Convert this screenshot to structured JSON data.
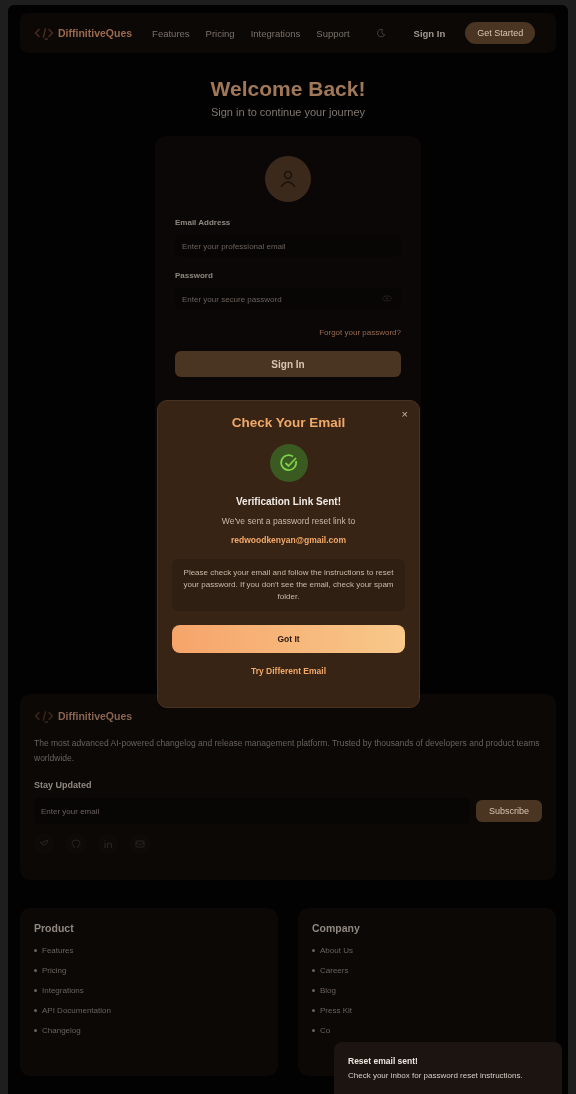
{
  "header": {
    "brand": "DiffinitiveQues",
    "nav": [
      "Features",
      "Pricing",
      "Integrations",
      "Support"
    ],
    "sign_in": "Sign In",
    "cta": "Get Started"
  },
  "login": {
    "title": "Welcome Back!",
    "subtitle": "Sign in to continue your journey",
    "email": {
      "label": "Email Address",
      "placeholder": "Enter your professional email"
    },
    "password": {
      "label": "Password",
      "placeholder": "Enter your secure password"
    },
    "forgot": "Forgot your password?",
    "submit": "Sign In"
  },
  "modal": {
    "title": "Check Your Email",
    "close": "×",
    "heading": "Verification Link Sent!",
    "message": "We've sent a password reset link to",
    "email": "redwoodkenyan@gmail.com",
    "note": "Please check your email and follow the instructions to reset your password. If you don't see the email, check your spam folder.",
    "primary": "Got It",
    "secondary": "Try Different Email"
  },
  "footer": {
    "brand": "DiffinitiveQues",
    "description": "The most advanced AI-powered changelog and release management platform. Trusted by thousands of developers and product teams worldwide.",
    "newsletter": {
      "label": "Stay Updated",
      "placeholder": "Enter your email",
      "button": "Subscribe"
    }
  },
  "link_groups": [
    {
      "title": "Product",
      "links": [
        "Features",
        "Pricing",
        "Integrations",
        "API Documentation",
        "Changelog"
      ]
    },
    {
      "title": "Company",
      "links": [
        "About Us",
        "Careers",
        "Blog",
        "Press Kit",
        "Co"
      ]
    }
  ],
  "toast": {
    "title": "Reset email sent!",
    "message": "Check your inbox for password reset instructions."
  }
}
